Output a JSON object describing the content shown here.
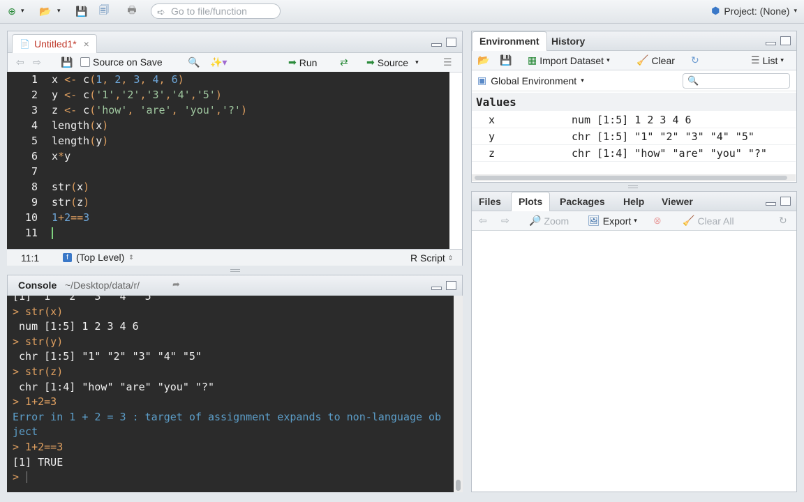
{
  "toolbar": {
    "goto_placeholder": "Go to file/function",
    "project_label": "Project: (None)"
  },
  "editor": {
    "tab_label": "Untitled1*",
    "source_on_save": "Source on Save",
    "run_label": "Run",
    "source_label": "Source",
    "lines": [
      {
        "n": "1",
        "text": "x <- c(1, 2, 3, 4, 6)"
      },
      {
        "n": "2",
        "text": "y <- c('1','2','3','4','5')"
      },
      {
        "n": "3",
        "text": "z <- c('how', 'are', 'you','?')"
      },
      {
        "n": "4",
        "text": "length(x)"
      },
      {
        "n": "5",
        "text": "length(y)"
      },
      {
        "n": "6",
        "text": "x*y"
      },
      {
        "n": "7",
        "text": ""
      },
      {
        "n": "8",
        "text": "str(x)"
      },
      {
        "n": "9",
        "text": "str(z)"
      },
      {
        "n": "10",
        "text": "1+2==3"
      },
      {
        "n": "11",
        "text": ""
      }
    ],
    "status_position": "11:1",
    "status_scope": "(Top Level)",
    "status_type": "R Script"
  },
  "console": {
    "title": "Console",
    "path": "~/Desktop/data/r/",
    "lines": [
      {
        "kind": "out",
        "text": "[1] \"1\" \"2\" \"3\" \"4\" \"5\""
      },
      {
        "kind": "cmd",
        "text": "> str(x)"
      },
      {
        "kind": "out",
        "text": " num [1:5] 1 2 3 4 6"
      },
      {
        "kind": "cmd",
        "text": "> str(y)"
      },
      {
        "kind": "out",
        "text": " chr [1:5] \"1\" \"2\" \"3\" \"4\" \"5\""
      },
      {
        "kind": "cmd",
        "text": "> str(z)"
      },
      {
        "kind": "out",
        "text": " chr [1:4] \"how\" \"are\" \"you\" \"?\""
      },
      {
        "kind": "cmd",
        "text": "> 1+2=3"
      },
      {
        "kind": "err",
        "text": "Error in 1 + 2 = 3 : target of assignment expands to non-language ob"
      },
      {
        "kind": "err",
        "text": "ject"
      },
      {
        "kind": "cmd",
        "text": "> 1+2==3"
      },
      {
        "kind": "out",
        "text": "[1] TRUE"
      },
      {
        "kind": "cmd",
        "text": "> "
      }
    ]
  },
  "environment": {
    "tabs": [
      "Environment",
      "History"
    ],
    "import_label": "Import Dataset",
    "clear_label": "Clear",
    "view_label": "List",
    "scope_label": "Global Environment",
    "values_heading": "Values",
    "rows": [
      {
        "name": "x",
        "value": "num [1:5] 1 2 3 4 6"
      },
      {
        "name": "y",
        "value": "chr [1:5] \"1\" \"2\" \"3\" \"4\" \"5\""
      },
      {
        "name": "z",
        "value": "chr [1:4] \"how\" \"are\" \"you\" \"?\""
      }
    ]
  },
  "files": {
    "tabs": [
      "Files",
      "Plots",
      "Packages",
      "Help",
      "Viewer"
    ],
    "zoom_label": "Zoom",
    "export_label": "Export",
    "clear_all_label": "Clear All"
  },
  "colors": {
    "editor_bg": "#2b2b2b",
    "keyword": "#f0f0f0",
    "number": "#6ea6d8",
    "string": "#a0c8a0",
    "operator": "#e0a060",
    "error": "#5c9ec9"
  }
}
